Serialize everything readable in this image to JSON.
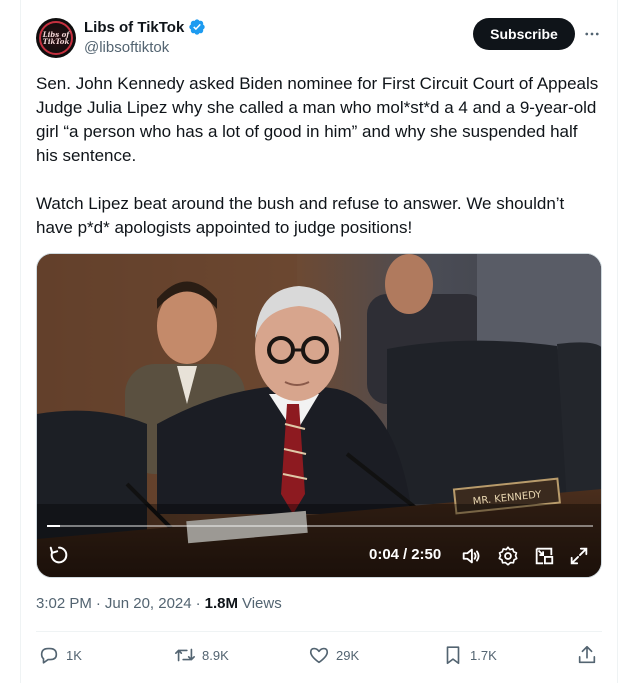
{
  "author": {
    "display_name": "Libs of TikTok",
    "handle": "@libsoftiktok",
    "avatar_text_line1": "Libs of",
    "avatar_text_line2": "TikTok",
    "verified": true,
    "verified_color": "#1d9bf0"
  },
  "header": {
    "subscribe_label": "Subscribe",
    "more_icon": "more-horizontal-icon"
  },
  "tweet": {
    "paragraph_1": "Sen. John Kennedy asked Biden nominee for First Circuit Court of Appeals Judge Julia Lipez why she called a man who mol*st*d a 4 and a 9-year-old girl “a person who has a lot of good in him” and why she suspended half his sentence.",
    "paragraph_2": "Watch Lipez beat around the bush and refuse to answer. We shouldn’t have p*d* apologists appointed to judge positions!"
  },
  "video": {
    "current_time": "0:04",
    "separator": "/",
    "duration": "2:50",
    "progress_fraction": 0.024,
    "nameplate_text": "MR. KENNEDY",
    "controls": [
      "replay-icon",
      "volume-icon",
      "settings-icon",
      "picture-in-picture-icon",
      "fullscreen-icon"
    ]
  },
  "meta": {
    "time": "3:02 PM",
    "dot": "·",
    "date": "Jun 20, 2024",
    "dot2": "·",
    "views_count": "1.8M",
    "views_label": "Views"
  },
  "actions": {
    "replies": "1K",
    "reposts": "8.9K",
    "likes": "29K",
    "bookmarks": "1.7K"
  },
  "colors": {
    "text_primary": "#0f1419",
    "text_secondary": "#536471",
    "border": "#eff3f4",
    "button_bg": "#0f1419"
  }
}
